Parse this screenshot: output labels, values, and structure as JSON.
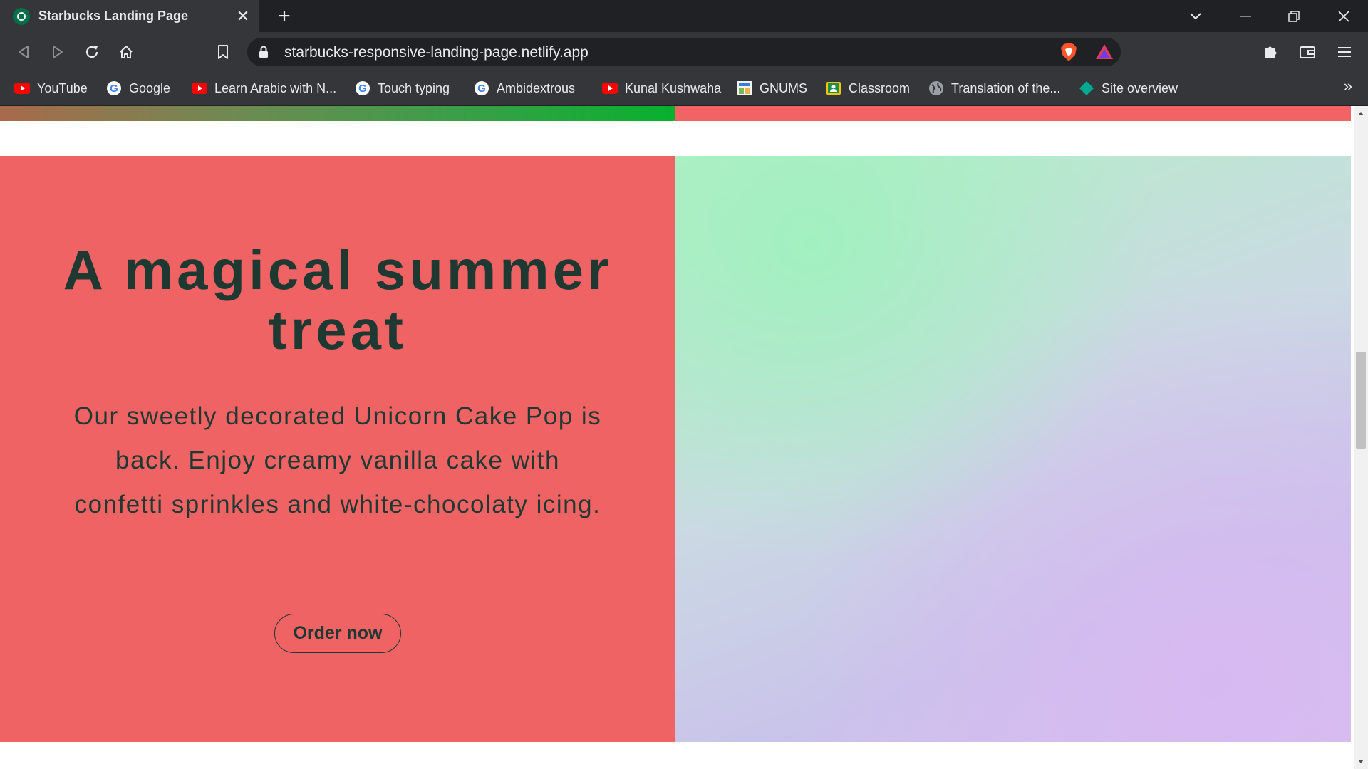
{
  "browser": {
    "tab": {
      "title": "Starbucks Landing Page",
      "close": "✕"
    },
    "new_tab": "+",
    "url": "starbucks-responsive-landing-page.netlify.app",
    "bookmarks": [
      {
        "label": "YouTube",
        "icon": "youtube-icon"
      },
      {
        "label": "Google",
        "icon": "google-icon"
      },
      {
        "label": "Learn Arabic with N...",
        "icon": "youtube-icon"
      },
      {
        "label": "Touch typing",
        "icon": "google-icon"
      },
      {
        "label": "Ambidextrous",
        "icon": "google-icon"
      },
      {
        "label": "Kunal Kushwaha",
        "icon": "youtube-icon"
      },
      {
        "label": "GNUMS",
        "icon": "gnums-icon"
      },
      {
        "label": "Classroom",
        "icon": "classroom-icon"
      },
      {
        "label": "Translation of the...",
        "icon": "globe-icon"
      },
      {
        "label": "Site overview",
        "icon": "diamond-icon"
      }
    ],
    "bookmarks_overflow": "»"
  },
  "page": {
    "hero": {
      "title": "A magical summer treat",
      "text": "Our sweetly decorated Unicorn Cake Pop is back. Enjoy creamy vanilla cake with confetti sprinkles and white-chocolaty icing.",
      "button": "Order now"
    }
  },
  "colors": {
    "hero_left": "#f06364",
    "text": "#1e3932",
    "chrome_dark": "#202124",
    "chrome": "#35363a"
  }
}
